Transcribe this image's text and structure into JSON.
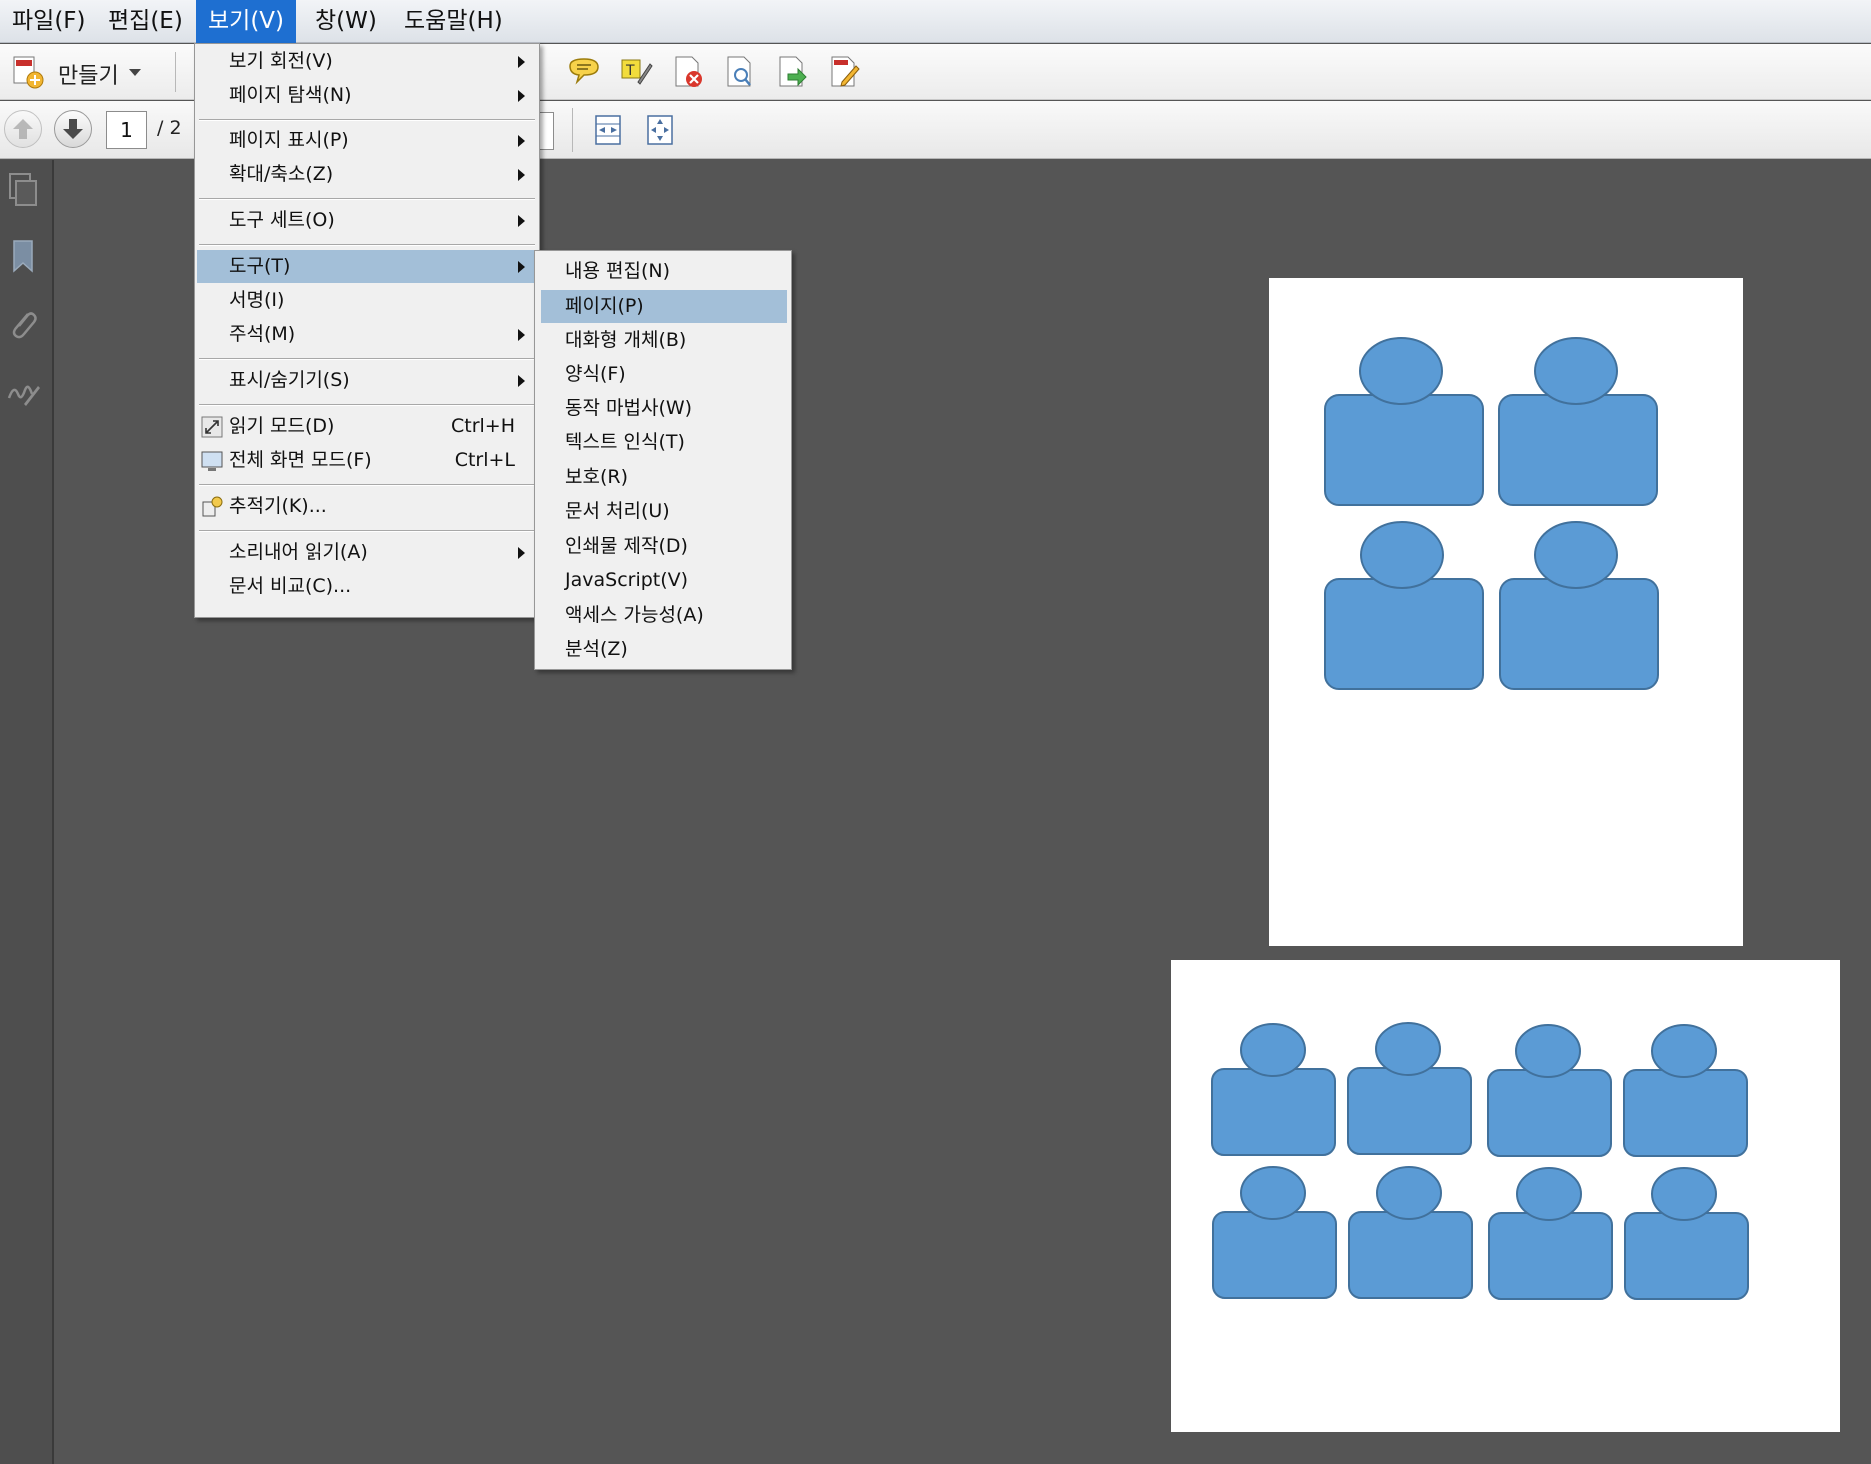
{
  "menubar": {
    "file": "파일(F)",
    "edit": "편집(E)",
    "view": "보기(V)",
    "window": "창(W)",
    "help": "도움말(H)"
  },
  "toolbar": {
    "create_label": "만들기",
    "page_number": "1",
    "page_total": "/ 2"
  },
  "view_menu": {
    "items": [
      {
        "label": "보기 회전(V)"
      },
      {
        "label": "페이지 탐색(N)"
      },
      {
        "label": "페이지 표시(P)"
      },
      {
        "label": "확대/축소(Z)"
      },
      {
        "label": "도구 세트(O)"
      },
      {
        "label": "도구(T)"
      },
      {
        "label": "서명(I)"
      },
      {
        "label": "주석(M)"
      },
      {
        "label": "표시/숨기기(S)"
      },
      {
        "label": "읽기 모드(D)",
        "shortcut": "Ctrl+H"
      },
      {
        "label": "전체 화면 모드(F)",
        "shortcut": "Ctrl+L"
      },
      {
        "label": "추적기(K)..."
      },
      {
        "label": "소리내어 읽기(A)"
      },
      {
        "label": "문서 비교(C)..."
      }
    ]
  },
  "tools_submenu": {
    "items": [
      {
        "label": "내용 편집(N)"
      },
      {
        "label": "페이지(P)"
      },
      {
        "label": "대화형 개체(B)"
      },
      {
        "label": "양식(F)"
      },
      {
        "label": "동작 마법사(W)"
      },
      {
        "label": "텍스트 인식(T)"
      },
      {
        "label": "보호(R)"
      },
      {
        "label": "문서 처리(U)"
      },
      {
        "label": "인쇄물 제작(D)"
      },
      {
        "label": "JavaScript(V)"
      },
      {
        "label": "액세스 가능성(A)"
      },
      {
        "label": "분석(Z)"
      }
    ]
  },
  "colors": {
    "figure_fill": "#5b9bd5",
    "figure_stroke": "#41719c",
    "menu_highlight": "#a3bfd8",
    "menubar_active": "#1e6fd1",
    "canvas_bg": "#555555"
  },
  "icons": {
    "create": "create-pdf-icon",
    "comment": "speech-bubble-icon",
    "prev_page": "arrow-up-icon",
    "next_page": "arrow-down-icon"
  }
}
